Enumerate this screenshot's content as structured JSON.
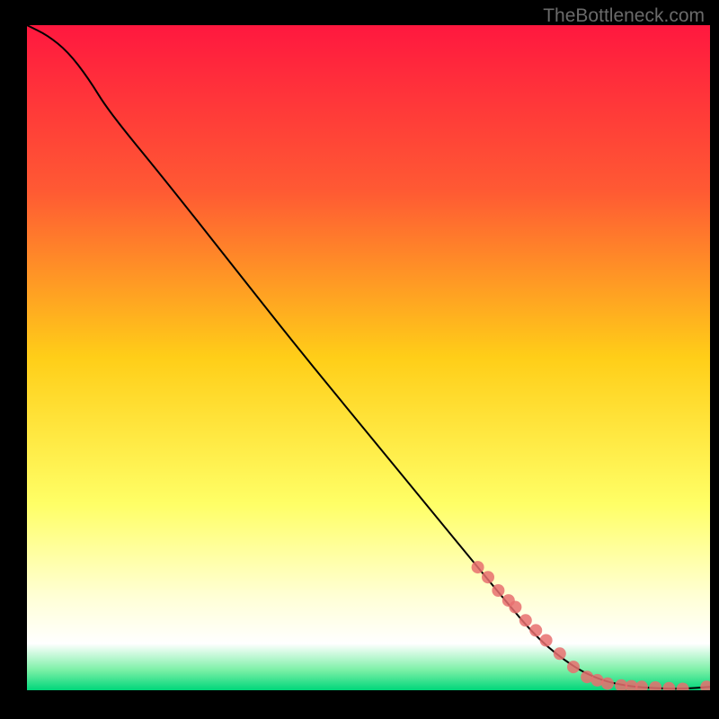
{
  "watermark": "TheBottleneck.com",
  "chart_data": {
    "type": "line",
    "title": "",
    "xlabel": "",
    "ylabel": "",
    "xlim": [
      0,
      100
    ],
    "ylim": [
      0,
      100
    ],
    "gradient_stops": [
      {
        "y": 0,
        "color": "#ff183f"
      },
      {
        "y": 25,
        "color": "#ff5a33"
      },
      {
        "y": 50,
        "color": "#ffce18"
      },
      {
        "y": 72,
        "color": "#ffff66"
      },
      {
        "y": 86,
        "color": "#ffffd6"
      },
      {
        "y": 93,
        "color": "#ffffff"
      },
      {
        "y": 97,
        "color": "#7af0a6"
      },
      {
        "y": 100,
        "color": "#00d67a"
      }
    ],
    "series": [
      {
        "name": "curve",
        "stroke": "#000000",
        "x": [
          0,
          3,
          6,
          9,
          12,
          20,
          30,
          40,
          50,
          60,
          70,
          75,
          80,
          84,
          88,
          92,
          96,
          100
        ],
        "y": [
          100,
          98.5,
          96,
          92,
          87,
          77,
          64,
          51,
          38.5,
          26,
          13.5,
          7.5,
          3.5,
          1.5,
          0.6,
          0.3,
          0.2,
          0.5
        ]
      }
    ],
    "markers": [
      {
        "name": "highlight-points",
        "color": "#e76f6f",
        "x": [
          66,
          67.5,
          69,
          70.5,
          71.5,
          73,
          74.5,
          76,
          78,
          80,
          82,
          83.5,
          85,
          87,
          88.5,
          90,
          92,
          94,
          96,
          99.5
        ],
        "y": [
          18.5,
          17,
          15,
          13.5,
          12.5,
          10.5,
          9,
          7.5,
          5.5,
          3.5,
          2,
          1.5,
          1,
          0.7,
          0.6,
          0.5,
          0.4,
          0.3,
          0.2,
          0.5
        ]
      }
    ]
  }
}
